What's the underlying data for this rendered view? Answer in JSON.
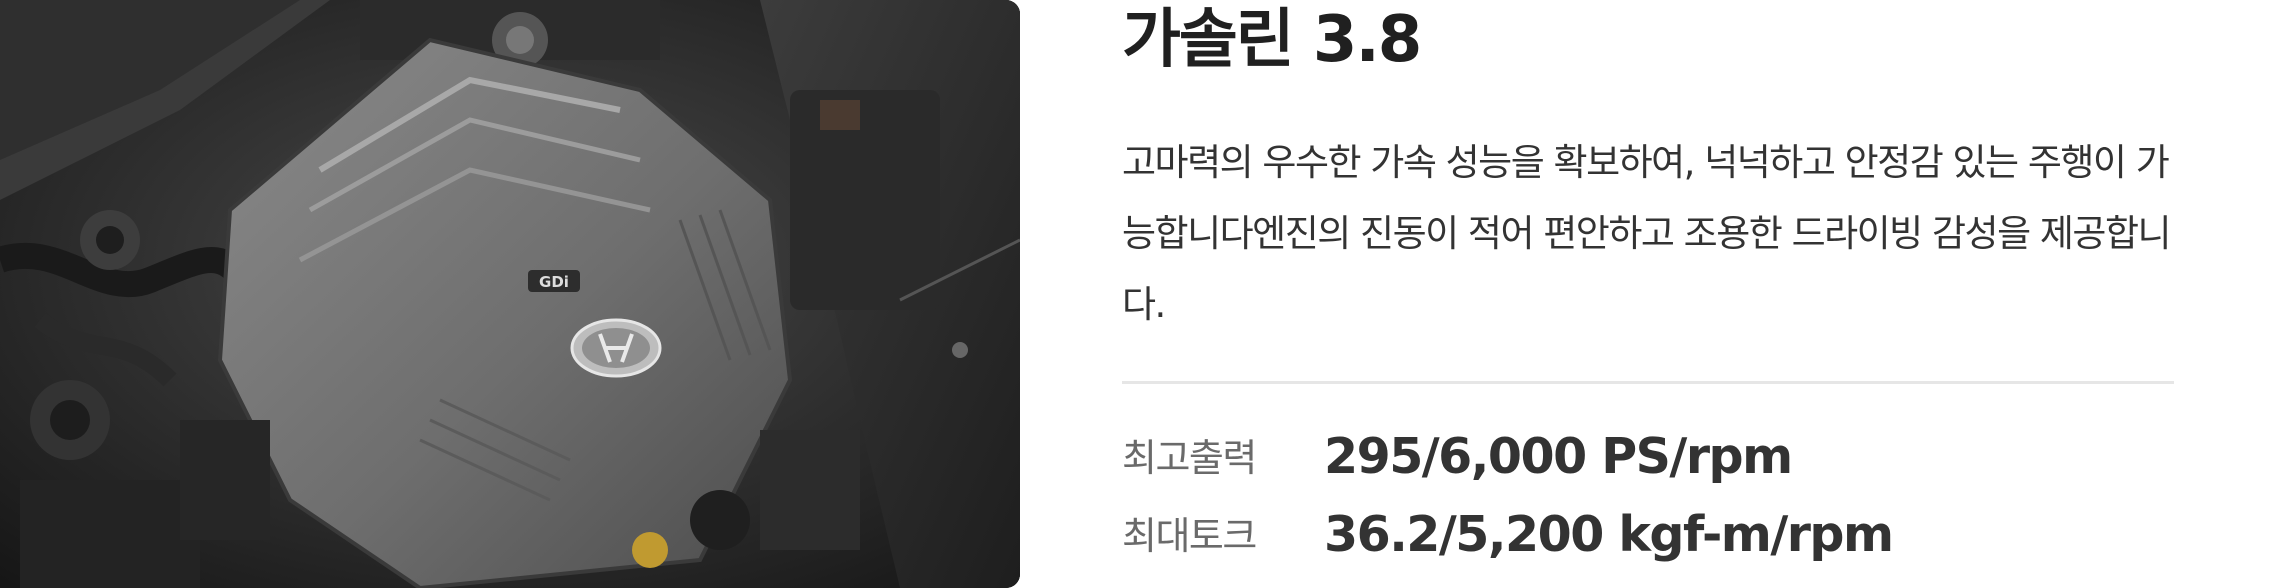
{
  "image": {
    "alt_icon": "engine-photo",
    "badge_text": "GDi"
  },
  "title": "가솔린 3.8",
  "description": "고마력의 우수한 가속 성능을 확보하여, 넉넉하고 안정감 있는 주행이 가능합니다엔진의 진동이 적어 편안하고 조용한 드라이빙 감성을 제공합니다.",
  "specs": [
    {
      "label": "최고출력",
      "value": "295/6,000 PS/rpm"
    },
    {
      "label": "최대토크",
      "value": "36.2/5,200 kgf-m/rpm"
    }
  ],
  "colors": {
    "title": "#202020",
    "body_text": "#333333",
    "spec_label": "#6a6a6a",
    "divider": "#e6e6e6"
  }
}
